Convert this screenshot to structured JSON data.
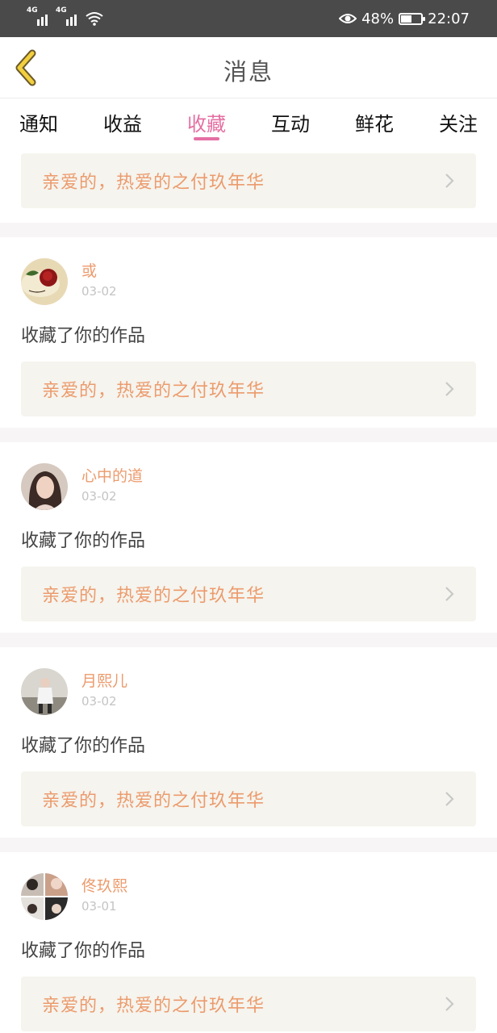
{
  "status_bar": {
    "network_1": "4G",
    "network_2": "4G",
    "battery": "48%",
    "battery_level": 0.48,
    "time": "22:07"
  },
  "nav": {
    "title": "消息",
    "back_icon": "chevron-left-icon"
  },
  "tabs": [
    {
      "label": "通知",
      "active": false
    },
    {
      "label": "收益",
      "active": false
    },
    {
      "label": "收藏",
      "active": true
    },
    {
      "label": "互动",
      "active": false
    },
    {
      "label": "鲜花",
      "active": false
    },
    {
      "label": "关注",
      "active": false
    }
  ],
  "first_work": {
    "title": "亲爱的，热爱的之付玖年华"
  },
  "notifications": [
    {
      "user": "或",
      "date": "03-02",
      "action": "收藏了你的作品",
      "work": "亲爱的，热爱的之付玖年华"
    },
    {
      "user": "心中的道",
      "date": "03-02",
      "action": "收藏了你的作品",
      "work": "亲爱的，热爱的之付玖年华"
    },
    {
      "user": "月熙儿",
      "date": "03-02",
      "action": "收藏了你的作品",
      "work": "亲爱的，热爱的之付玖年华"
    },
    {
      "user": "佟玖熙",
      "date": "03-01",
      "action": "收藏了你的作品",
      "work": "亲爱的，热爱的之付玖年华"
    }
  ],
  "colors": {
    "accent": "#e56fa3",
    "work_text": "#ec9b6d",
    "work_bg": "#f5f4ee",
    "status_bg": "#4a4a4a"
  }
}
